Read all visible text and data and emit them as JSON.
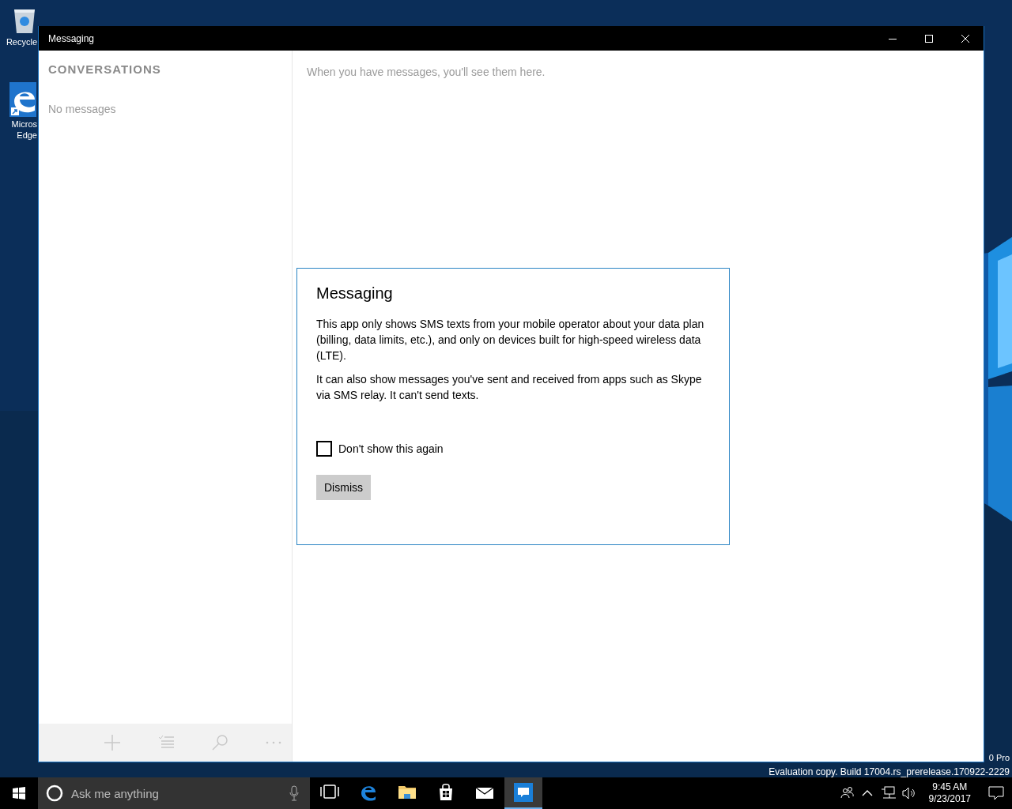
{
  "desktop": {
    "icons": [
      {
        "kind": "recycle-bin",
        "lines": [
          "Recycle"
        ]
      },
      {
        "kind": "edge",
        "lines": [
          "Micros",
          "Edge"
        ]
      }
    ],
    "watermark": [
      "0 Pro",
      "Evaluation copy. Build 17004.rs_prerelease.170922-2229"
    ]
  },
  "window": {
    "title": "Messaging",
    "controls": [
      {
        "kind": "minimize"
      },
      {
        "kind": "maximize"
      },
      {
        "kind": "close"
      }
    ]
  },
  "sidebar": {
    "heading": "CONVERSATIONS",
    "empty_text": "No messages",
    "toolbar": [
      {
        "kind": "add",
        "disabled": true
      },
      {
        "kind": "select",
        "disabled": true
      },
      {
        "kind": "search",
        "disabled": true
      },
      {
        "kind": "more",
        "disabled": true
      }
    ]
  },
  "main": {
    "empty_text": "When you have messages, you'll see them here."
  },
  "dialog": {
    "title": "Messaging",
    "paragraphs": [
      "This app only shows SMS texts from your mobile operator about your data plan (billing, data limits, etc.), and only on devices built for high-speed wireless data (LTE).",
      "It can also show messages you've sent and received from apps such as Skype via SMS relay. It can't send texts."
    ],
    "checkbox": {
      "label": "Don't show this again",
      "checked": false
    },
    "button": "Dismiss"
  },
  "taskbar": {
    "search": {
      "placeholder": "Ask me anything"
    },
    "apps": [
      {
        "kind": "task-view",
        "selected": false
      },
      {
        "kind": "edge",
        "selected": false
      },
      {
        "kind": "folder",
        "selected": false
      },
      {
        "kind": "store",
        "selected": false
      },
      {
        "kind": "mail",
        "selected": false
      },
      {
        "kind": "messaging",
        "selected": true
      }
    ],
    "tray": [
      {
        "kind": "people"
      },
      {
        "kind": "chevron"
      },
      {
        "kind": "network"
      },
      {
        "kind": "volume"
      }
    ],
    "time": "9:45 AM",
    "date": "9/23/2017"
  }
}
